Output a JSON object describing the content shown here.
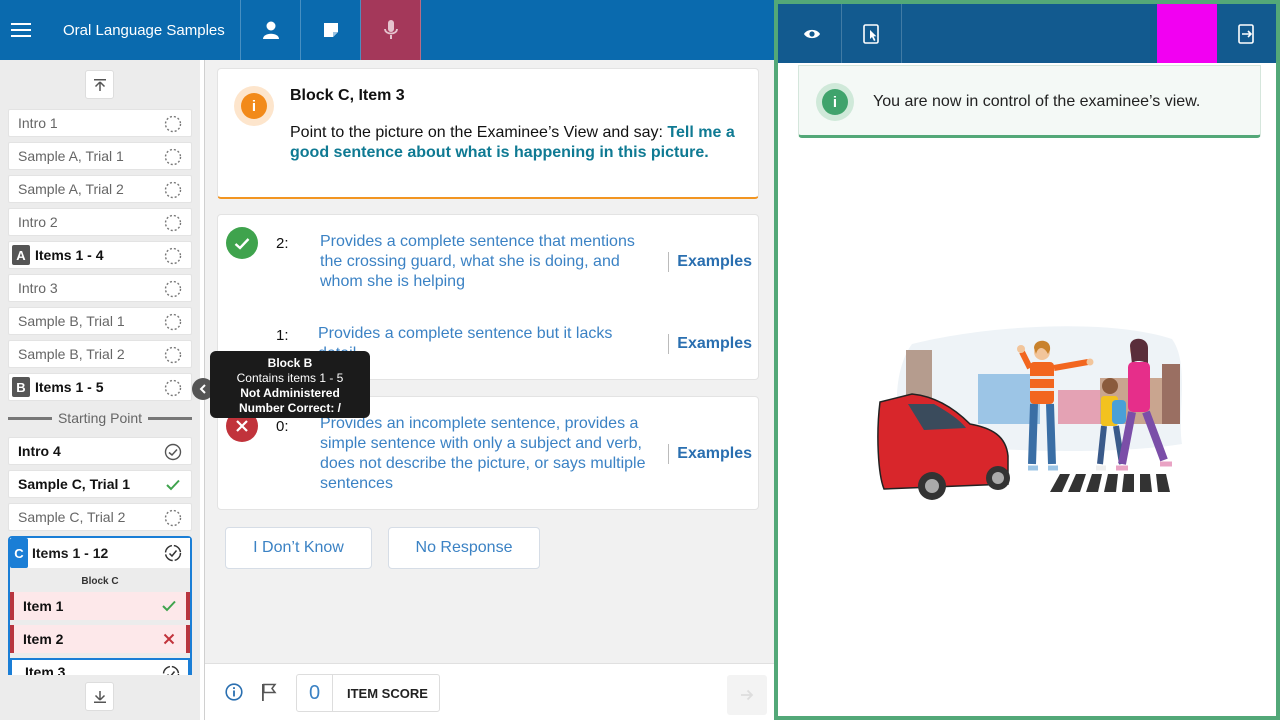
{
  "header": {
    "app_title": "Oral Language Samples",
    "menu_icon": "hamburger-icon",
    "buttons": [
      "person-icon",
      "notes-icon",
      "microphone-icon"
    ]
  },
  "sidebar": {
    "items": [
      {
        "label": "Intro 1",
        "status": "not-started"
      },
      {
        "label": "Sample A, Trial 1",
        "status": "not-started"
      },
      {
        "label": "Sample A, Trial 2",
        "status": "not-started"
      },
      {
        "label": "Intro 2",
        "status": "not-started"
      },
      {
        "block": "A",
        "label": "Items 1 - 4",
        "status": "not-started"
      },
      {
        "label": "Intro 3",
        "status": "not-started"
      },
      {
        "label": "Sample B, Trial 1",
        "status": "not-started"
      },
      {
        "label": "Sample B, Trial 2",
        "status": "not-started"
      },
      {
        "block": "B",
        "label": "Items 1 - 5",
        "status": "not-started"
      }
    ],
    "starting_point": "Starting Point",
    "after_start": [
      {
        "label": "Intro 4",
        "status": "complete"
      },
      {
        "label": "Sample C, Trial 1",
        "status": "correct"
      },
      {
        "label": "Sample C, Trial 2",
        "status": "not-started"
      }
    ],
    "block_c": {
      "block": "C",
      "label": "Items 1 - 12",
      "caption": "Block C",
      "items": [
        {
          "label": "Item 1",
          "status": "correct"
        },
        {
          "label": "Item 2",
          "status": "incorrect"
        },
        {
          "label": "Item 3",
          "status": "in-progress"
        }
      ]
    }
  },
  "tooltip": {
    "title": "Block B",
    "line1": "Contains items 1 - 5",
    "line2": "Not Administered",
    "line3": "Number Correct: /"
  },
  "prompt": {
    "title": "Block C, Item 3",
    "instruction": "Point to the picture on the Examinee’s View and say: ",
    "quote": "Tell me a good sentence about what is happening in this picture."
  },
  "scores": [
    {
      "value": "2:",
      "desc": "Provides a complete sentence that mentions the crossing guard, what she is doing, and whom she is helping",
      "examples": "Examples"
    },
    {
      "value": "1:",
      "desc": "Provides a complete sentence but it lacks detail",
      "examples": "Examples"
    },
    {
      "value": "0:",
      "desc": "Provides an incomplete sentence, provides a simple sentence with only a subject and verb, does not describe the picture, or says multiple sentences",
      "examples": "Examples"
    }
  ],
  "responses": {
    "dont_know": "I Don’t Know",
    "no_response": "No Response"
  },
  "footer": {
    "item_score_value": "0",
    "item_score_label": "ITEM SCORE"
  },
  "examinee": {
    "notice": "You are now in control of the examinee’s view.",
    "toolbar": [
      "eye-icon",
      "touch-screen-icon",
      "exit-screen-icon"
    ],
    "highlight_color": "#f200f2"
  },
  "colors": {
    "header_blue": "#0a6aae",
    "mic_active": "#a4385a",
    "accent_orange": "#f29521",
    "correct_green": "#3fa34d",
    "incorrect_red": "#c1333b",
    "link_blue": "#3b82c4",
    "examinee_border": "#53a878"
  }
}
